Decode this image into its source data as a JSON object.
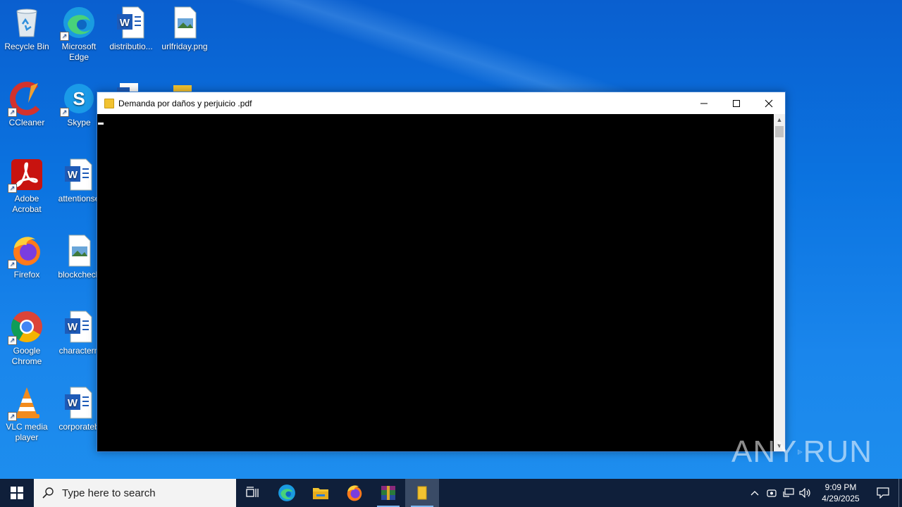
{
  "desktop": {
    "icons": [
      {
        "label": "Recycle Bin",
        "icon": "recycle-bin-icon"
      },
      {
        "label": "Microsoft Edge",
        "icon": "edge-icon"
      },
      {
        "label": "distributio...",
        "icon": "word-doc-icon"
      },
      {
        "label": "urlfriday.png",
        "icon": "image-file-icon"
      },
      {
        "label": "CCleaner",
        "icon": "ccleaner-icon"
      },
      {
        "label": "Skype",
        "icon": "skype-icon"
      },
      {
        "label": "Adobe Acrobat",
        "icon": "acrobat-icon"
      },
      {
        "label": "attentionse",
        "icon": "word-doc-icon"
      },
      {
        "label": "Firefox",
        "icon": "firefox-icon"
      },
      {
        "label": "blockcheck",
        "icon": "image-file-icon"
      },
      {
        "label": "Google Chrome",
        "icon": "chrome-icon"
      },
      {
        "label": "charactern",
        "icon": "word-doc-icon"
      },
      {
        "label": "VLC media player",
        "icon": "vlc-icon"
      },
      {
        "label": "corporateb",
        "icon": "word-doc-icon"
      }
    ]
  },
  "window": {
    "title": "Demanda por daños y perjuicio .pdf",
    "icon": "folder-icon"
  },
  "watermark": {
    "left": "ANY",
    "right": "RUN"
  },
  "taskbar": {
    "search_placeholder": "Type here to search",
    "apps": [
      "task-view-icon",
      "edge-icon",
      "file-explorer-icon",
      "firefox-icon",
      "winrar-icon",
      "folder-icon"
    ],
    "clock": {
      "time": "9:09 PM",
      "date": "4/29/2025"
    }
  },
  "colors": {
    "desktop": "#0b73e0",
    "taskbar": "#0f1f3a",
    "console": "#000000"
  }
}
